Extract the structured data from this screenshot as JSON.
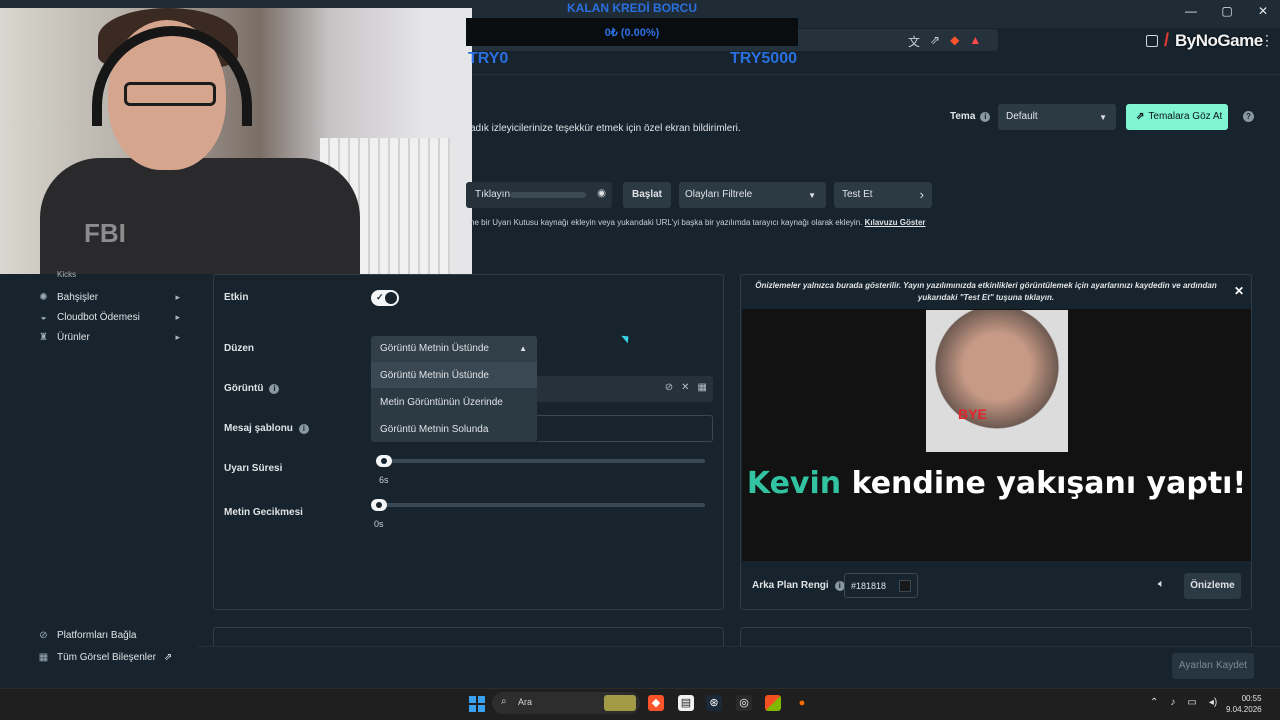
{
  "overlay": {
    "credit_title": "KALAN KREDİ BORCU",
    "credit_progress": "0₺ (0.00%)",
    "credit_min": "TRY0",
    "credit_max": "TRY5000",
    "accent_color": "#2a6fe0"
  },
  "browser": {
    "brand": "ByNoGame",
    "menu_icon": "more-vert-icon",
    "window_controls": [
      "—",
      "▢",
      "✕"
    ]
  },
  "header": {
    "description": "adık izleyicilerinize teşekkür etmek için özel ekran bildirimleri.",
    "theme_label": "Tema",
    "theme_value": "Default",
    "browse_themes": "Temalara Göz At",
    "browse_color": "#80f5d2"
  },
  "source": {
    "url_label": "Tıklayın",
    "start_button": "Başlat",
    "filter_placeholder": "Olayları Filtrele",
    "test_button": "Test Et",
    "hint_text": "he bir Uyarı Kutusu kaynağı ekleyin veya yukarıdaki URL'yi başka bir yazılımda tarayıcı kaynağı olarak ekleyin.",
    "hint_link": "Kılavuzu Göster"
  },
  "sidebar": {
    "kicks_label": "Kicks",
    "items": [
      {
        "label": "Bahşişler",
        "icon": "coins-icon"
      },
      {
        "label": "Cloudbot Ödemesi",
        "icon": "cloudbot-icon"
      },
      {
        "label": "Ürünler",
        "icon": "shirt-icon"
      }
    ],
    "footer": [
      {
        "label": "Platformları Bağla",
        "icon": "link-icon"
      },
      {
        "label": "Tüm Görsel Bileşenler",
        "icon": "grid-icon"
      }
    ]
  },
  "settings": {
    "enabled_label": "Etkin",
    "enabled": true,
    "layout_label": "Düzen",
    "layout_value": "Görüntü Metnin Üstünde",
    "layout_options": [
      "Görüntü Metnin Üstünde",
      "Metin Görüntünün Üzerinde",
      "Görüntü Metnin Solunda"
    ],
    "image_label": "Görüntü",
    "template_label": "Mesaj şablonu",
    "duration_label": "Uyarı Süresi",
    "duration_value": "6s",
    "duration_fraction": 0.0,
    "delay_label": "Metin Gecikmesi",
    "delay_value": "0s",
    "delay_fraction": 0.0
  },
  "preview": {
    "note": "Önizlemeler yalnızca burada gösterilir. Yayın yazılımınızda etkinlikleri görüntülemek için ayarlarınızı kaydedin ve ardından yukarıdaki \"Test Et\" tuşuna tıklayın.",
    "image_text": "BYE",
    "name": "Kevin",
    "message": " kendine yakışanı yaptı!",
    "name_color": "#32c3a2",
    "bg_label": "Arka Plan Rengi",
    "bg_value": "#181818",
    "preview_button": "Önizleme"
  },
  "footer": {
    "save_button": "Ayarları Kaydet"
  },
  "taskbar": {
    "search_placeholder": "Ara",
    "time": "00:55",
    "date": "9.04.2026"
  }
}
